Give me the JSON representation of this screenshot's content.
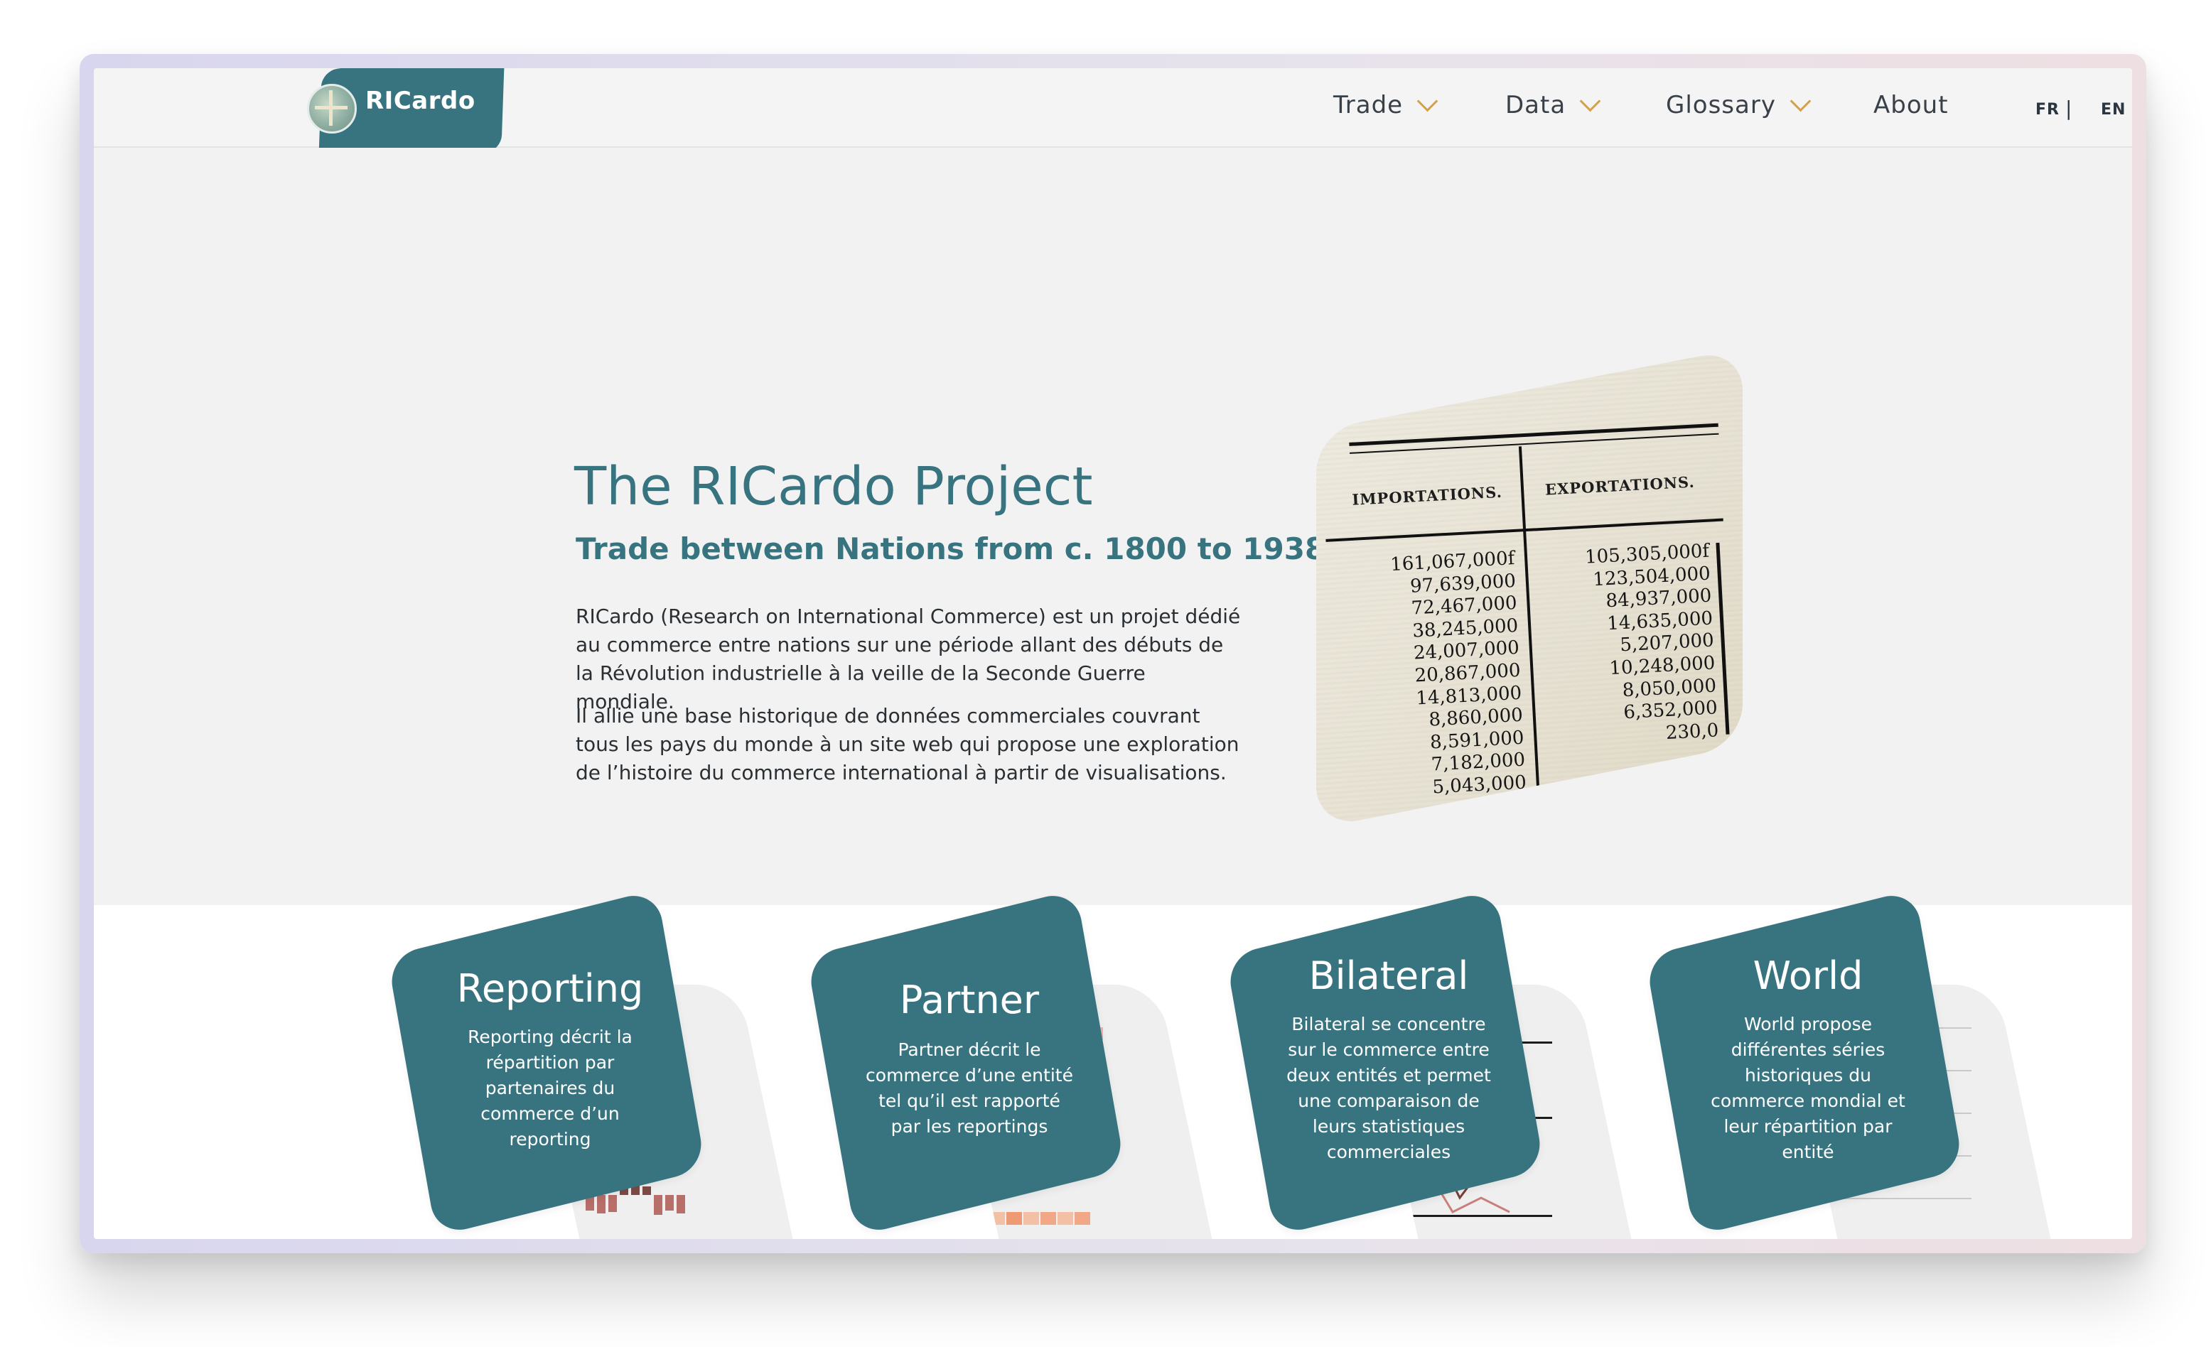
{
  "brand": {
    "name": "RICardo"
  },
  "nav": {
    "items": [
      {
        "label": "Trade",
        "has_dropdown": true
      },
      {
        "label": "Data",
        "has_dropdown": true
      },
      {
        "label": "Glossary",
        "has_dropdown": true
      },
      {
        "label": "About",
        "has_dropdown": false
      }
    ],
    "languages": [
      "FR",
      "EN"
    ],
    "lang_separator": "|"
  },
  "hero": {
    "title": "The RICardo Project",
    "subtitle": "Trade between Nations from c. 1800 to 1938",
    "paragraphs": [
      "RICardo (Research on International Commerce) est un projet dédié au commerce entre nations sur une période allant des débuts de la Révolution industrielle à la veille de la Seconde Guerre mondiale.",
      "Il allie une base historique de données commerciales couvrant tous les pays du monde à un site web qui propose une exploration de l’histoire du commerce international à partir de visualisations."
    ],
    "archive": {
      "col1_header": "IMPORTATIONS.",
      "col2_header": "EXPORTATIONS.",
      "imports": [
        "161,067,000f",
        "97,639,000",
        "72,467,000",
        "38,245,000",
        "24,007,000",
        "20,867,000",
        "14,813,000",
        "8,860,000",
        "8,591,000",
        "7,182,000",
        "5,043,000"
      ],
      "exports": [
        "105,305,000f",
        "123,504,000",
        "84,937,000",
        "14,635,000",
        "5,207,000",
        "10,248,000",
        "8,050,000",
        "6,352,000",
        "230,0"
      ]
    }
  },
  "cards": [
    {
      "title": "Reporting",
      "desc_lines": [
        "Reporting décrit la",
        "répartition par",
        "partenaires du",
        "commerce d’un",
        "reporting"
      ]
    },
    {
      "title": "Partner",
      "desc_lines": [
        "Partner décrit le",
        "commerce d’une entité",
        "tel qu’il est rapporté",
        "par les reportings"
      ]
    },
    {
      "title": "Bilateral",
      "desc_lines": [
        "Bilateral se concentre",
        "sur le commerce entre",
        "deux entités et permet",
        "une comparaison de",
        "leurs statistiques",
        "commerciales"
      ]
    },
    {
      "title": "World",
      "desc_lines": [
        "World propose",
        "différentes séries",
        "historiques du",
        "commerce mondial et",
        "leur répartition par",
        "entité"
      ]
    }
  ],
  "colors": {
    "brand_teal": "#387480",
    "accent_gold": "#d3a14a",
    "hero_bg": "#f2f2f2"
  }
}
